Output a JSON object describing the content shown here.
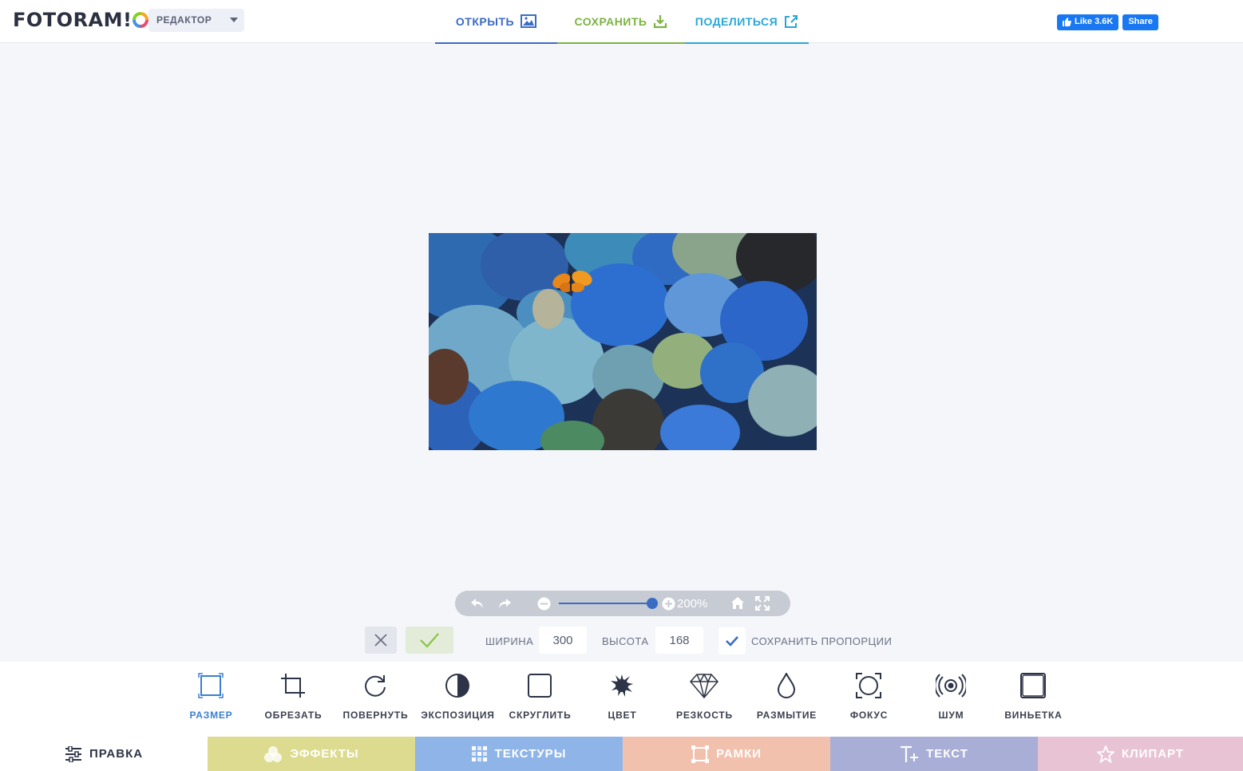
{
  "header": {
    "logo_text": "FOTORAM!",
    "mode": {
      "selected": "РЕДАКТОР",
      "icon": "chevron-down-icon"
    },
    "nav": [
      {
        "label": "ОТКРЫТЬ",
        "icon": "image-icon",
        "color": "#3b6cc4"
      },
      {
        "label": "СОХРАНИТЬ",
        "icon": "download-icon",
        "color": "#7cb342"
      },
      {
        "label": "ПОДЕЛИТЬСЯ",
        "icon": "share-icon",
        "color": "#29a7d8"
      }
    ],
    "facebook": {
      "like_label": "Like 3.6K",
      "share_label": "Share",
      "color": "#1877f2"
    }
  },
  "zoom": {
    "value_label": "200%",
    "level": 0.93,
    "icons": [
      "undo-icon",
      "redo-icon",
      "zoom-out-icon",
      "zoom-in-icon",
      "home-icon",
      "fullscreen-icon"
    ]
  },
  "resize": {
    "width_label": "ШИРИНА",
    "width_value": "300",
    "height_label": "ВЫСОТА",
    "height_value": "168",
    "keep_ratio_label": "СОХРАНИТЬ ПРОПОРЦИИ",
    "keep_ratio_checked": true
  },
  "tools": [
    {
      "label": "РАЗМЕР",
      "icon": "resize-icon",
      "active": true
    },
    {
      "label": "ОБРЕЗАТЬ",
      "icon": "crop-icon"
    },
    {
      "label": "ПОВЕРНУТЬ",
      "icon": "rotate-icon"
    },
    {
      "label": "ЭКСПОЗИЦИЯ",
      "icon": "exposure-icon"
    },
    {
      "label": "СКРУГЛИТЬ",
      "icon": "round-corners-icon"
    },
    {
      "label": "ЦВЕТ",
      "icon": "color-splash-icon"
    },
    {
      "label": "РЕЗКОСТЬ",
      "icon": "diamond-icon"
    },
    {
      "label": "РАЗМЫТИЕ",
      "icon": "drop-icon"
    },
    {
      "label": "ФОКУС",
      "icon": "focus-icon"
    },
    {
      "label": "ШУМ",
      "icon": "noise-icon"
    },
    {
      "label": "ВИНЬЕТКА",
      "icon": "vignette-icon"
    }
  ],
  "tabs": [
    {
      "label": "ПРАВКА",
      "icon": "sliders-icon",
      "color": "#ffffff"
    },
    {
      "label": "ЭФФЕКТЫ",
      "icon": "circles-icon",
      "color": "#dcdb8f"
    },
    {
      "label": "ТЕКСТУРЫ",
      "icon": "grid-icon",
      "color": "#8fb5e8"
    },
    {
      "label": "РАМКИ",
      "icon": "frame-icon",
      "color": "#f1c1ae"
    },
    {
      "label": "ТЕКСТ",
      "icon": "text-plus-icon",
      "color": "#a9aed6"
    },
    {
      "label": "КЛИПАРТ",
      "icon": "star-icon",
      "color": "#e8c3d4"
    }
  ]
}
